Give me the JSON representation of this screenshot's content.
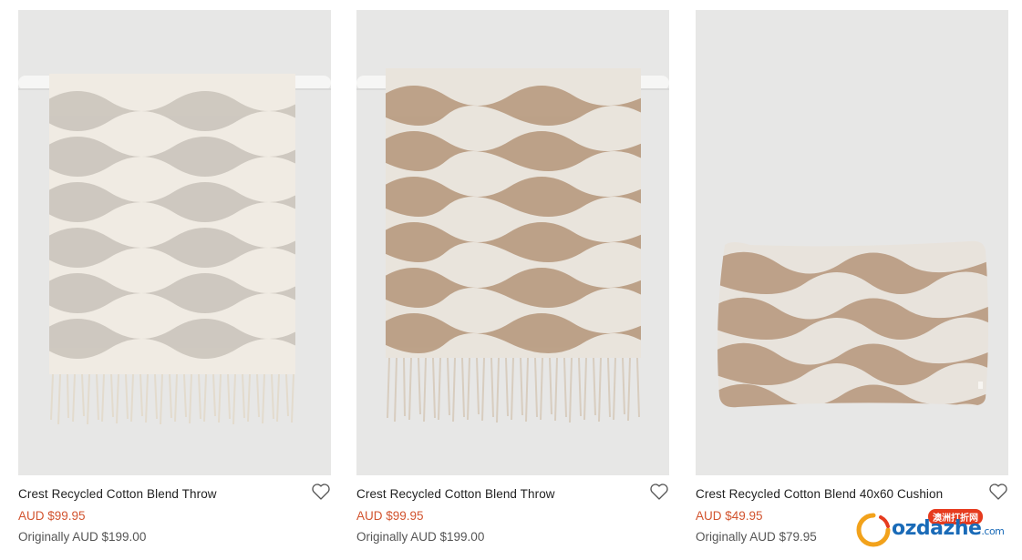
{
  "products": [
    {
      "title": "Crest Recycled Cotton Blend Throw",
      "price": "AUD $99.95",
      "original": "Originally AUD $199.00",
      "image_alt": "cream and grey wave throw",
      "colors": {
        "light": "#f0ebe3",
        "stripe": "#c9c3ba",
        "fringe": "#e9e2d6"
      }
    },
    {
      "title": "Crest Recycled Cotton Blend Throw",
      "price": "AUD $99.95",
      "original": "Originally AUD $199.00",
      "image_alt": "beige and taupe wave throw",
      "colors": {
        "light": "#e9e4dc",
        "stripe": "#b89a80",
        "fringe": "#ddd3c6"
      }
    },
    {
      "title": "Crest Recycled Cotton Blend 40x60 Cushion",
      "price": "AUD $49.95",
      "original": "Originally AUD $79.95",
      "image_alt": "beige and taupe wave cushion",
      "colors": {
        "light": "#e8e3dc",
        "stripe": "#b89a80"
      }
    }
  ],
  "watermark": {
    "brand": "ozdazhe",
    "suffix": ".com",
    "chinese": "澳洲打折网"
  },
  "colors": {
    "sale_price": "#d2542f",
    "image_background": "#e7e7e6"
  },
  "icons": {
    "wishlist": "heart-outline-icon"
  }
}
